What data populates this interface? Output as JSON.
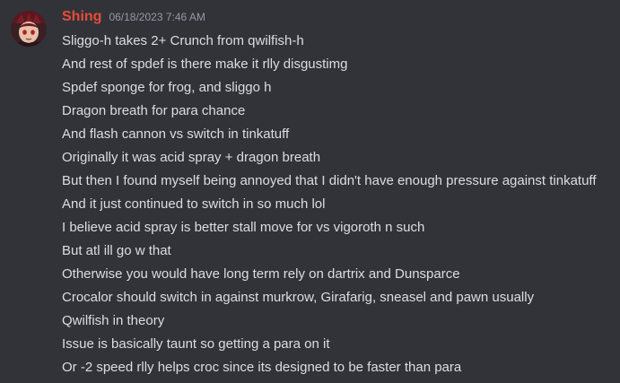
{
  "message": {
    "username": "Shing",
    "timestamp": "06/18/2023 7:46 AM",
    "avatar_icon": "avatar-icon",
    "username_color": "#e84b3c",
    "lines": [
      "Sliggo-h takes 2+ Crunch from qwilfish-h",
      "And rest of spdef is there make it rlly disgustimg",
      "Spdef sponge for frog, and sliggo h",
      "Dragon breath for para chance",
      "And flash cannon vs switch in tinkatuff",
      "Originally it was acid spray + dragon breath",
      "But then I found myself being annoyed that I didn't have enough pressure against tinkatuff",
      "And it just continued to switch in so much lol",
      "I believe acid spray is better stall move for vs vigoroth n such",
      "But atl ill go w that",
      "Otherwise you would have long term rely on dartrix and Dunsparce",
      "Crocalor should switch in against murkrow, Girafarig, sneasel and pawn usually",
      "Qwilfish in theory",
      "Issue is basically taunt so getting a para on it",
      "Or -2 speed rlly helps croc since its designed to be faster than para"
    ]
  }
}
